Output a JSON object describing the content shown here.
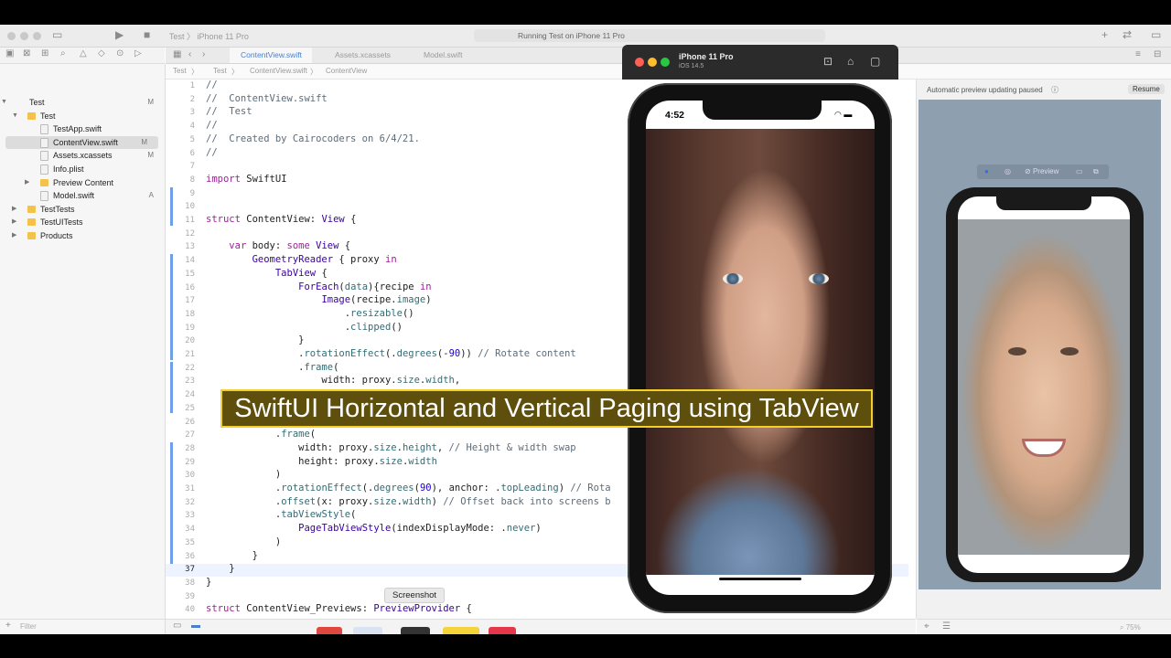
{
  "toolbar": {
    "scheme_project": "Test",
    "scheme_device": "iPhone 11 Pro",
    "status": "Running Test on iPhone 11 Pro"
  },
  "tabs": [
    {
      "label": "ContentView.swift",
      "active": true
    },
    {
      "label": "Assets.xcassets",
      "active": false
    },
    {
      "label": "Model.swift",
      "active": false
    }
  ],
  "jumpbar": [
    "Test",
    "Test",
    "ContentView.swift",
    "ContentView"
  ],
  "navigator": {
    "items": [
      {
        "label": "Test",
        "badge": "M",
        "kind": "project",
        "indent": 0,
        "disclosure": "open"
      },
      {
        "label": "Test",
        "badge": "",
        "kind": "folder",
        "indent": 1,
        "disclosure": "open"
      },
      {
        "label": "TestApp.swift",
        "badge": "",
        "kind": "swift",
        "indent": 2,
        "disclosure": ""
      },
      {
        "label": "ContentView.swift",
        "badge": "M",
        "kind": "swift",
        "indent": 2,
        "disclosure": "",
        "selected": true
      },
      {
        "label": "Assets.xcassets",
        "badge": "M",
        "kind": "swift",
        "indent": 2,
        "disclosure": ""
      },
      {
        "label": "Info.plist",
        "badge": "",
        "kind": "swift",
        "indent": 2,
        "disclosure": ""
      },
      {
        "label": "Preview Content",
        "badge": "",
        "kind": "folder",
        "indent": 2,
        "disclosure": "closed"
      },
      {
        "label": "Model.swift",
        "badge": "A",
        "kind": "swift",
        "indent": 2,
        "disclosure": ""
      },
      {
        "label": "TestTests",
        "badge": "",
        "kind": "folder",
        "indent": 1,
        "disclosure": "closed"
      },
      {
        "label": "TestUITests",
        "badge": "",
        "kind": "folder",
        "indent": 1,
        "disclosure": "closed"
      },
      {
        "label": "Products",
        "badge": "",
        "kind": "folder",
        "indent": 1,
        "disclosure": "closed"
      }
    ],
    "filter_placeholder": "Filter"
  },
  "code_lines": [
    {
      "n": "1",
      "html": "<span class='cm'>//</span>"
    },
    {
      "n": "2",
      "html": "<span class='cm'>//  ContentView.swift</span>"
    },
    {
      "n": "3",
      "html": "<span class='cm'>//  Test</span>"
    },
    {
      "n": "4",
      "html": "<span class='cm'>//</span>"
    },
    {
      "n": "5",
      "html": "<span class='cm'>//  Created by Cairocoders on 6/4/21.</span>"
    },
    {
      "n": "6",
      "html": "<span class='cm'>//</span>"
    },
    {
      "n": "7",
      "html": ""
    },
    {
      "n": "8",
      "html": "<span class='kw'>import</span> SwiftUI"
    },
    {
      "n": "9",
      "html": ""
    },
    {
      "n": "10",
      "html": ""
    },
    {
      "n": "11",
      "html": "<span class='kw'>struct</span> ContentView: <span class='ty'>View</span> {"
    },
    {
      "n": "12",
      "html": ""
    },
    {
      "n": "13",
      "html": "    <span class='kw'>var</span> body: <span class='kw'>some</span> <span class='ty'>View</span> {"
    },
    {
      "n": "14",
      "html": "        <span class='ty'>GeometryReader</span> { proxy <span class='kw'>in</span>"
    },
    {
      "n": "15",
      "html": "            <span class='ty'>TabView</span> {"
    },
    {
      "n": "16",
      "html": "                <span class='ty'>ForEach</span>(<span class='fn'>data</span>){recipe <span class='kw'>in</span>"
    },
    {
      "n": "17",
      "html": "                    <span class='ty'>Image</span>(recipe.<span class='fn'>image</span>)"
    },
    {
      "n": "18",
      "html": "                        .<span class='fn'>resizable</span>()"
    },
    {
      "n": "19",
      "html": "                        .<span class='fn'>clipped</span>()"
    },
    {
      "n": "20",
      "html": "                }"
    },
    {
      "n": "21",
      "html": "                .<span class='fn'>rotationEffect</span>(.<span class='fn'>degrees</span>(-<span class='num'>90</span>)) <span class='cm'>// Rotate content</span>"
    },
    {
      "n": "22",
      "html": "                .<span class='fn'>frame</span>("
    },
    {
      "n": "23",
      "html": "                    width: proxy.<span class='fn'>size</span>.<span class='fn'>width</span>,"
    },
    {
      "n": "24",
      "html": ""
    },
    {
      "n": "25",
      "html": ""
    },
    {
      "n": "26",
      "html": ""
    },
    {
      "n": "27",
      "html": "            .<span class='fn'>frame</span>("
    },
    {
      "n": "28",
      "html": "                width: proxy.<span class='fn'>size</span>.<span class='fn'>height</span>, <span class='cm'>// Height &amp; width swap</span>"
    },
    {
      "n": "29",
      "html": "                height: proxy.<span class='fn'>size</span>.<span class='fn'>width</span>"
    },
    {
      "n": "30",
      "html": "            )"
    },
    {
      "n": "31",
      "html": "            .<span class='fn'>rotationEffect</span>(.<span class='fn'>degrees</span>(<span class='num'>90</span>), anchor: .<span class='fn'>topLeading</span>) <span class='cm'>// Rota</span>"
    },
    {
      "n": "32",
      "html": "            .<span class='fn'>offset</span>(x: proxy.<span class='fn'>size</span>.<span class='fn'>width</span>) <span class='cm'>// Offset back into screens b</span>"
    },
    {
      "n": "33",
      "html": "            .<span class='fn'>tabViewStyle</span>("
    },
    {
      "n": "34",
      "html": "                <span class='ty'>PageTabViewStyle</span>(indexDisplayMode: .<span class='fn'>never</span>)"
    },
    {
      "n": "35",
      "html": "            )"
    },
    {
      "n": "36",
      "html": "        }"
    },
    {
      "n": "37",
      "html": "    }"
    },
    {
      "n": "38",
      "html": "}"
    },
    {
      "n": "39",
      "html": ""
    },
    {
      "n": "40",
      "html": "<span class='kw'>struct</span> ContentView_Previews: <span class='ty'>PreviewProvider</span> {"
    }
  ],
  "current_line": "37",
  "canvas": {
    "paused_text": "Automatic preview updating paused",
    "resume_label": "Resume",
    "preview_label": "Preview",
    "zoom": "75%"
  },
  "simulator": {
    "device": "iPhone 11 Pro",
    "os": "iOS 14.5",
    "time": "4:52"
  },
  "screenshot_tooltip": "Screenshot",
  "overlay_title": "SwiftUI Horizontal and Vertical Paging using TabView",
  "colors": {
    "accent": "#4a7fd0",
    "overlay_border": "#f1cf2c",
    "overlay_bg": "#5e4f0c"
  }
}
